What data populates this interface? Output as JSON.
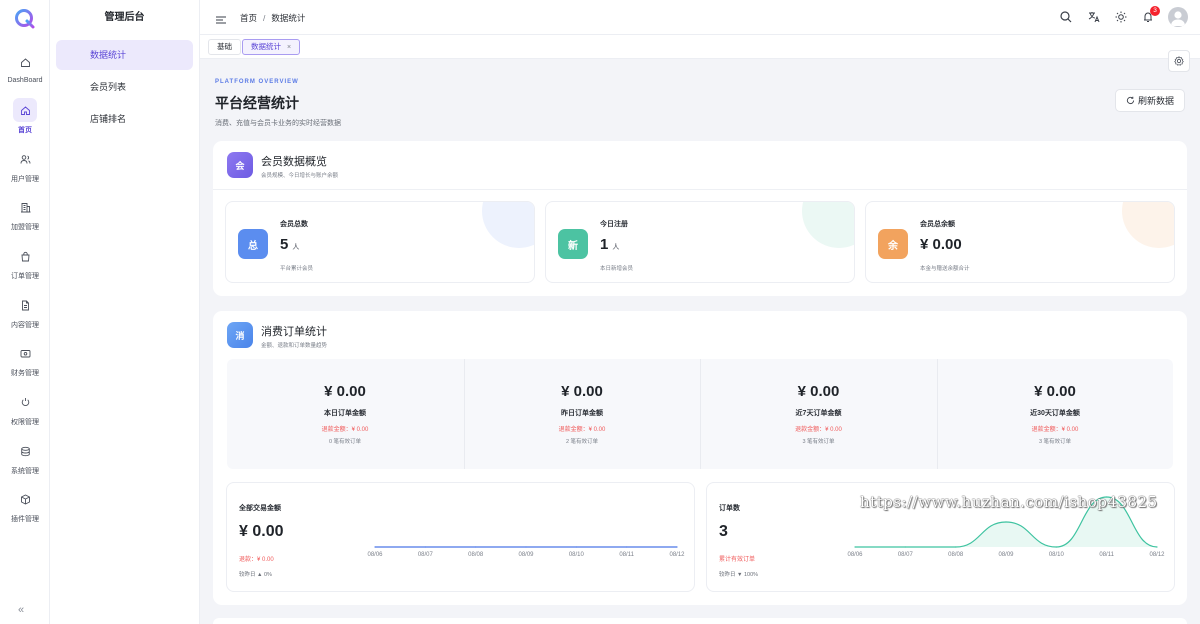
{
  "rail": {
    "items": [
      {
        "label": "DashBoard",
        "icon": "home-outline-icon"
      },
      {
        "label": "首页",
        "icon": "home-icon"
      },
      {
        "label": "用户管理",
        "icon": "users-icon"
      },
      {
        "label": "加盟管理",
        "icon": "building-icon"
      },
      {
        "label": "订单管理",
        "icon": "bag-icon"
      },
      {
        "label": "内容管理",
        "icon": "file-icon"
      },
      {
        "label": "财务管理",
        "icon": "wallet-icon"
      },
      {
        "label": "权限管理",
        "icon": "key-icon"
      },
      {
        "label": "系统管理",
        "icon": "database-icon"
      },
      {
        "label": "插件管理",
        "icon": "box-icon"
      }
    ],
    "collapse": "«"
  },
  "menu": {
    "title": "管理后台",
    "items": [
      {
        "label": "数据统计"
      },
      {
        "label": "会员列表"
      },
      {
        "label": "店铺排名"
      }
    ]
  },
  "header": {
    "breadcrumb": [
      "首页",
      "数据统计"
    ],
    "breadcrumb_sep": "/",
    "notif_count": "3"
  },
  "tabs": [
    {
      "label": "基础"
    },
    {
      "label": "数据统计",
      "close": "×"
    }
  ],
  "page": {
    "kicker": "PLATFORM OVERVIEW",
    "title": "平台经营统计",
    "subtitle": "消费、充值与会员卡业务的实时经营数据",
    "refresh_label": "刷新数据"
  },
  "members": {
    "badge": "会",
    "title": "会员数据概览",
    "subtitle": "会员规模、今日增长与账户余额",
    "stats": [
      {
        "badge": "总",
        "label": "会员总数",
        "value": "5",
        "unit": "人",
        "note": "平台累计会员",
        "color": "#5b8def",
        "blob": "#edf2fd"
      },
      {
        "badge": "新",
        "label": "今日注册",
        "value": "1",
        "unit": "人",
        "note": "本日新增会员",
        "color": "#4cc3a2",
        "blob": "#ebf8f4"
      },
      {
        "badge": "余",
        "label": "会员总余额",
        "value": "¥ 0.00",
        "unit": "",
        "note": "本金与赠送余额合计",
        "color": "#f2a35e",
        "blob": "#fdf3ea"
      }
    ]
  },
  "orders": {
    "badge": "消",
    "title": "消费订单统计",
    "subtitle": "金额、退款和订单数量趋势",
    "columns": [
      {
        "value": "¥ 0.00",
        "label": "本日订单金额",
        "refund": "退款金额：¥ 0.00",
        "count": "0 笔有效订单"
      },
      {
        "value": "¥ 0.00",
        "label": "昨日订单金额",
        "refund": "退款金额：¥ 0.00",
        "count": "2 笔有效订单"
      },
      {
        "value": "¥ 0.00",
        "label": "近7天订单金额",
        "refund": "退款金额：¥ 0.00",
        "count": "3 笔有效订单"
      },
      {
        "value": "¥ 0.00",
        "label": "近30天订单金额",
        "refund": "退款金额：¥ 0.00",
        "count": "3 笔有效订单"
      }
    ],
    "amount_card": {
      "title": "全部交易金额",
      "value": "¥ 0.00",
      "note": "退款：¥ 0.00",
      "compare": "较昨日 ▲ 0%"
    },
    "count_card": {
      "title": "订单数",
      "value": "3",
      "note": "累计有效订单",
      "compare": "较昨日 ▼ 100%"
    }
  },
  "chart_data": [
    {
      "type": "line",
      "x": [
        "08/06",
        "08/07",
        "08/08",
        "08/09",
        "08/10",
        "08/11",
        "08/12"
      ],
      "series": [
        {
          "values": [
            0,
            0,
            0,
            0,
            0,
            0,
            0
          ]
        }
      ],
      "color": "#4a76e8"
    },
    {
      "type": "area",
      "x": [
        "08/06",
        "08/07",
        "08/08",
        "08/09",
        "08/10",
        "08/11",
        "08/12"
      ],
      "series": [
        {
          "values": [
            0,
            0,
            0,
            1,
            0,
            2,
            0
          ]
        }
      ],
      "ylim": [
        0,
        2
      ],
      "color": "#3ec3a0"
    }
  ],
  "watermark": "https://www.huzhan.com/ishop43825"
}
